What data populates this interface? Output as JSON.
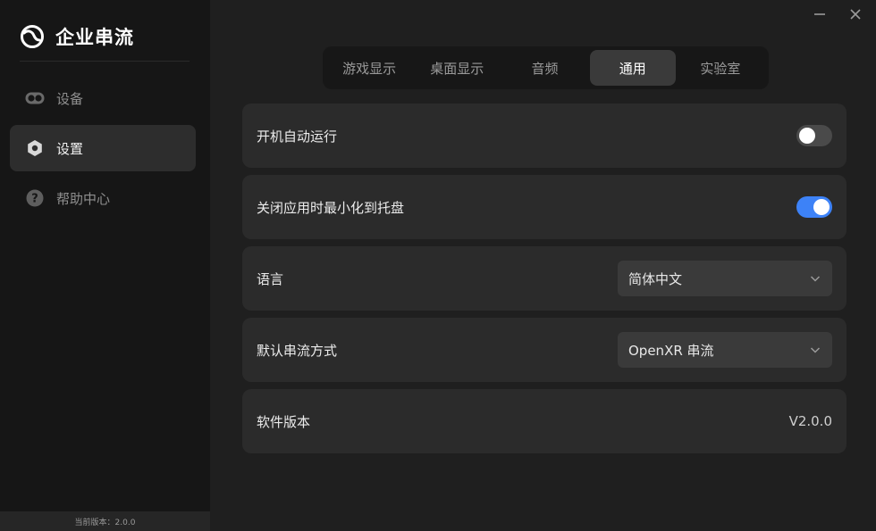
{
  "app": {
    "name": "企业串流",
    "footer_version": "当前版本：2.0.0"
  },
  "sidebar": {
    "items": [
      {
        "label": "设备",
        "icon": "vr-headset-icon",
        "active": false
      },
      {
        "label": "设置",
        "icon": "settings-icon",
        "active": true
      },
      {
        "label": "帮助中心",
        "icon": "help-icon",
        "active": false
      }
    ]
  },
  "tabs": [
    {
      "label": "游戏显示",
      "active": false
    },
    {
      "label": "桌面显示",
      "active": false
    },
    {
      "label": "音频",
      "active": false
    },
    {
      "label": "通用",
      "active": true
    },
    {
      "label": "实验室",
      "active": false
    }
  ],
  "settings": {
    "autostart": {
      "label": "开机自动运行",
      "enabled": false
    },
    "minimize_to_tray": {
      "label": "关闭应用时最小化到托盘",
      "enabled": true
    },
    "language": {
      "label": "语言",
      "value": "简体中文"
    },
    "stream_mode": {
      "label": "默认串流方式",
      "value": "OpenXR 串流"
    },
    "software_version": {
      "label": "软件版本",
      "value": "V2.0.0"
    }
  },
  "colors": {
    "accent": "#3d82f7",
    "background": "#1f1f1f",
    "sidebar": "#161616",
    "card": "#2b2b2b"
  }
}
